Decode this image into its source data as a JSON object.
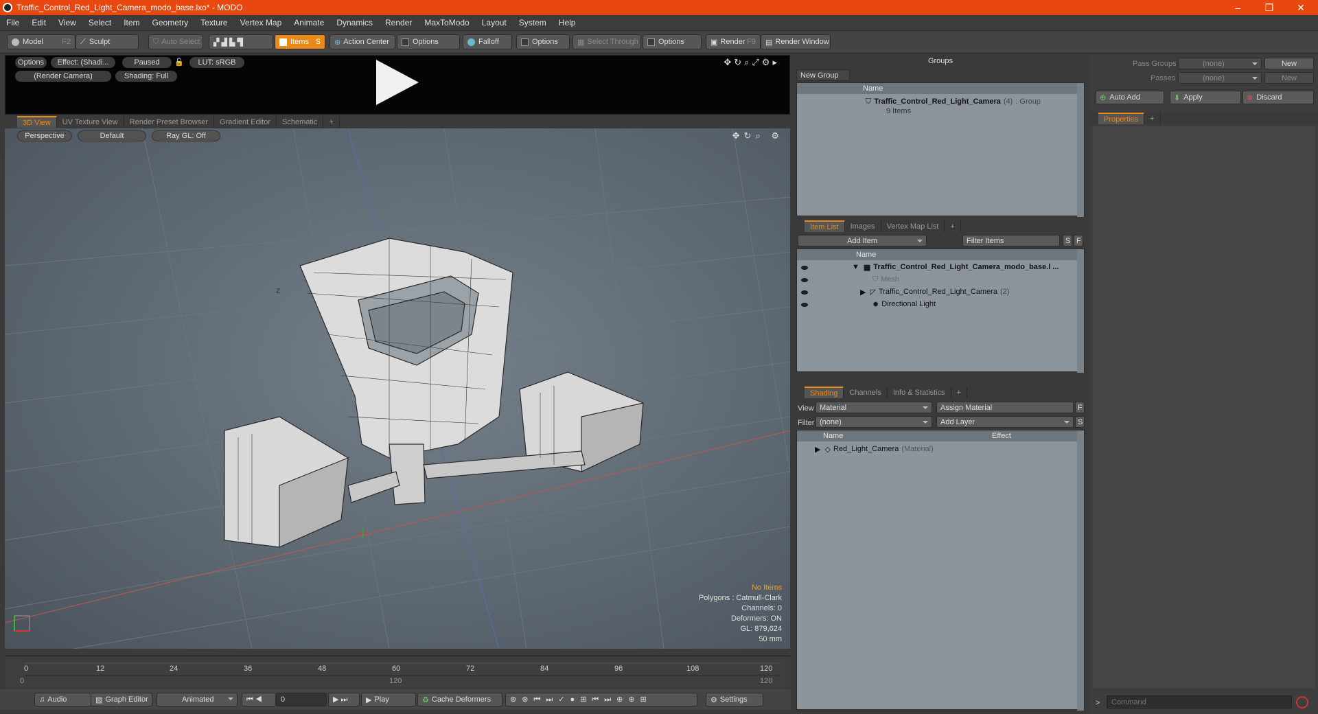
{
  "window": {
    "title": "Traffic_Control_Red_Light_Camera_modo_base.lxo* - MODO",
    "minimize": "–",
    "restore": "❐",
    "close": "✕"
  },
  "menu": [
    "File",
    "Edit",
    "View",
    "Select",
    "Item",
    "Geometry",
    "Texture",
    "Vertex Map",
    "Animate",
    "Dynamics",
    "Render",
    "MaxToModo",
    "Layout",
    "System",
    "Help"
  ],
  "toolbar": {
    "model": "Model",
    "model_key": "F2",
    "sculpt": "Sculpt",
    "auto_select": "Auto Select",
    "items": "Items",
    "items_key": "S",
    "action_center": "Action Center",
    "options1": "Options",
    "falloff": "Falloff",
    "options2": "Options",
    "select_through": "Select Through",
    "options3": "Options",
    "render": "Render",
    "render_key": "F9",
    "render_window": "Render Window"
  },
  "preview": {
    "options": "Options",
    "effect": "Effect: (Shadi...",
    "paused": "Paused",
    "lut": "LUT: sRGB",
    "camera": "(Render Camera)",
    "shading": "Shading: Full"
  },
  "view_tabs": [
    "3D View",
    "UV Texture View",
    "Render Preset Browser",
    "Gradient Editor",
    "Schematic",
    "+"
  ],
  "viewport": {
    "perspective": "Perspective",
    "default": "Default",
    "raygl": "Ray GL: Off",
    "axis_label": "Z"
  },
  "stats": {
    "no_items": "No Items",
    "polygons": "Polygons : Catmull-Clark",
    "channels": "Channels: 0",
    "deformers": "Deformers: ON",
    "gl": "GL: 879,624",
    "lens": "50 mm"
  },
  "timeline": {
    "ticks": [
      "0",
      "12",
      "24",
      "36",
      "48",
      "60",
      "72",
      "84",
      "96",
      "108",
      "120"
    ],
    "sub_left": "0",
    "sub_mid": "120",
    "sub_right": "120"
  },
  "bottom": {
    "audio": "Audio",
    "graph_editor": "Graph Editor",
    "animated": "Animated",
    "frame": "0",
    "play": "Play",
    "cache": "Cache Deformers",
    "settings": "Settings"
  },
  "groups": {
    "title": "Groups",
    "new_group": "New Group",
    "col_name": "Name",
    "item_name": "Traffic_Control_Red_Light_Camera",
    "item_count": "(4)",
    "item_type": ": Group",
    "item_sub": "9 Items"
  },
  "item_list_tabs": [
    "Item List",
    "Images",
    "Vertex Map List",
    "+"
  ],
  "item_list": {
    "add_item": "Add Item",
    "filter": "Filter Items",
    "s": "S",
    "f": "F",
    "col_name": "Name",
    "rows": [
      {
        "label": "Traffic_Control_Red_Light_Camera_modo_base.l ...",
        "extra": ""
      },
      {
        "label": "Mesh",
        "extra": ""
      },
      {
        "label": "Traffic_Control_Red_Light_Camera",
        "extra": "(2)"
      },
      {
        "label": "Directional Light",
        "extra": ""
      }
    ]
  },
  "shading_tabs": [
    "Shading",
    "Channels",
    "Info & Statistics",
    "+"
  ],
  "shading": {
    "view_label": "View",
    "view_value": "Material",
    "assign": "Assign Material",
    "f": "F",
    "filter_label": "Filter",
    "filter_value": "(none)",
    "add_layer": "Add Layer",
    "s": "S",
    "col_name": "Name",
    "col_effect": "Effect",
    "row_name": "Red_Light_Camera",
    "row_type": "(Material)"
  },
  "pass": {
    "pass_groups": "Pass Groups",
    "passes": "Passes",
    "none1": "(none)",
    "none2": "(none)",
    "new1": "New",
    "new2": "New",
    "auto_add": "Auto Add",
    "apply": "Apply",
    "discard": "Discard"
  },
  "properties": {
    "tab": "Properties",
    "plus": "+"
  },
  "command": {
    "prompt": ">",
    "placeholder": "Command"
  }
}
